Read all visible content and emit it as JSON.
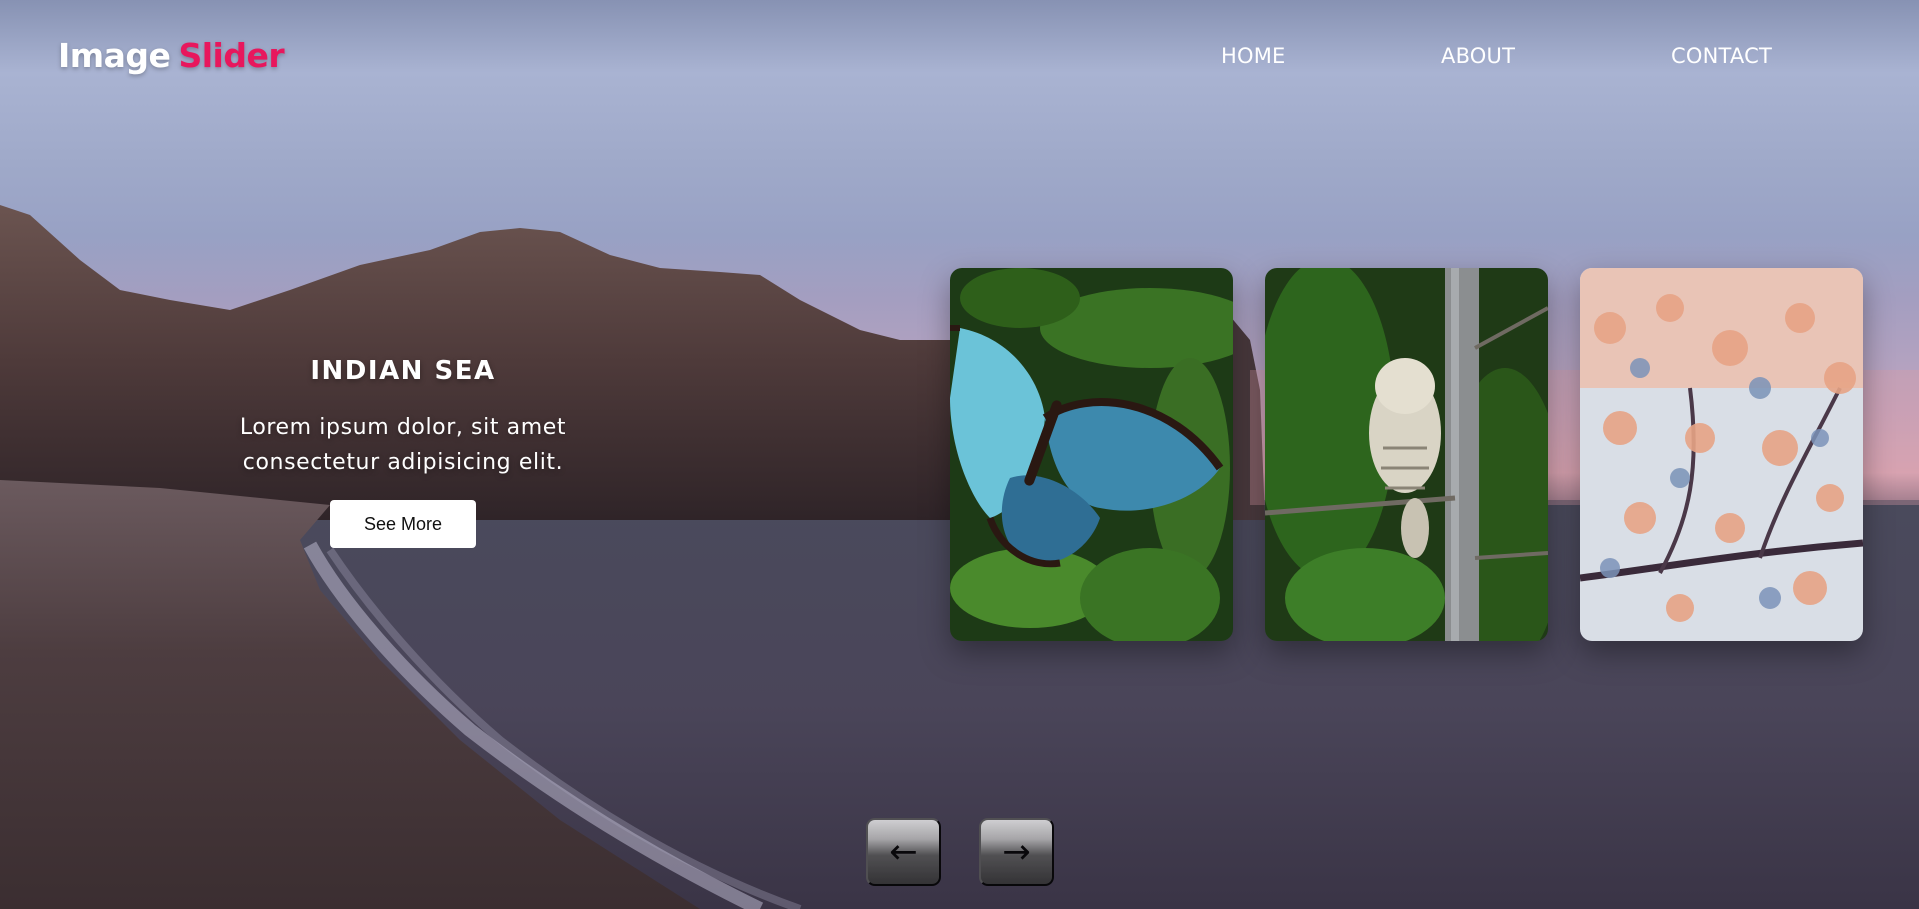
{
  "header": {
    "logo_word1": "Image",
    "logo_word2": "Slider",
    "nav": {
      "home": "HOME",
      "about": "ABOUT",
      "contact": "CONTACT"
    }
  },
  "slide": {
    "title": "INDIAN SEA",
    "description": "Lorem ipsum dolor, sit amet consectetur adipisicing elit.",
    "button_label": "See More"
  },
  "thumbnails": [
    {
      "subject": "butterfly"
    },
    {
      "subject": "owl"
    },
    {
      "subject": "blossom"
    }
  ],
  "controls": {
    "prev_icon": "←",
    "next_icon": "→"
  },
  "colors": {
    "accent": "#e8175d",
    "text": "#ffffff",
    "button_bg": "#ffffff"
  }
}
